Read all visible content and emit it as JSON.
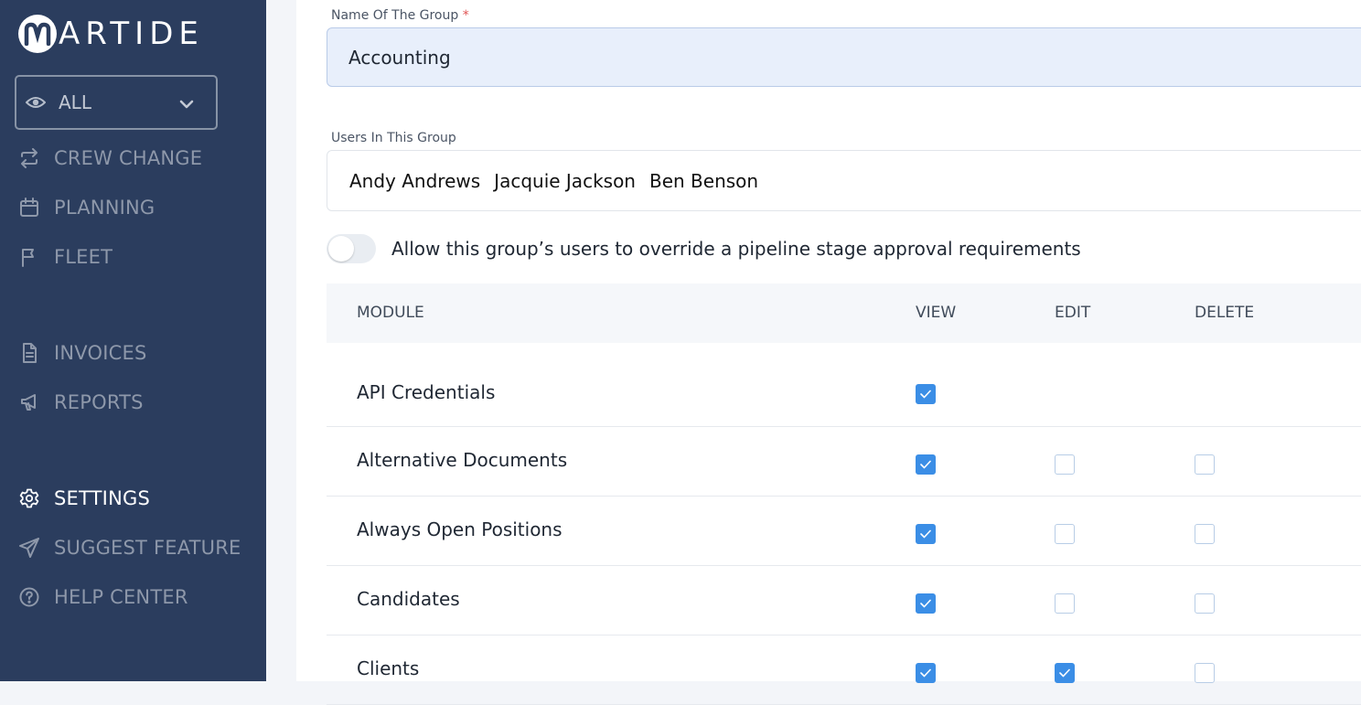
{
  "app": {
    "logo_text": "ARTIDE"
  },
  "sidebar": {
    "view_filter": {
      "value": "ALL"
    },
    "items": [
      {
        "label": "CREW CHANGE",
        "icon": "swap-arrows-icon"
      },
      {
        "label": "PLANNING",
        "icon": "calendar-icon"
      },
      {
        "label": "FLEET",
        "icon": "flag-icon"
      },
      {
        "label": "INVOICES",
        "icon": "document-icon"
      },
      {
        "label": "REPORTS",
        "icon": "megaphone-icon"
      },
      {
        "label": "SETTINGS",
        "icon": "gear-icon",
        "active": true
      },
      {
        "label": "SUGGEST FEATURE",
        "icon": "send-icon"
      },
      {
        "label": "HELP CENTER",
        "icon": "help-circle-icon"
      }
    ]
  },
  "form": {
    "group_name_label": "Name Of The Group",
    "required_mark": "*",
    "group_name_value": "Accounting",
    "users_label": "Users In This Group",
    "users": [
      "Andy Andrews",
      "Jacquie Jackson",
      "Ben Benson"
    ],
    "override_toggle_label": "Allow this group’s users to override a pipeline stage approval requirements",
    "override_enabled": false
  },
  "permissions": {
    "headers": {
      "module": "MODULE",
      "view": "VIEW",
      "edit": "EDIT",
      "delete": "DELETE"
    },
    "rows": [
      {
        "module": "API Credentials",
        "view": true,
        "edit": null,
        "delete": null
      },
      {
        "module": "Alternative Documents",
        "view": true,
        "edit": false,
        "delete": false
      },
      {
        "module": "Always Open Positions",
        "view": true,
        "edit": false,
        "delete": false
      },
      {
        "module": "Candidates",
        "view": true,
        "edit": false,
        "delete": false
      },
      {
        "module": "Clients",
        "view": true,
        "edit": true,
        "delete": false
      }
    ]
  },
  "colors": {
    "sidebar_bg": "#2b3d5e",
    "accent": "#3b8ee6",
    "input_bg": "#e8effb"
  }
}
